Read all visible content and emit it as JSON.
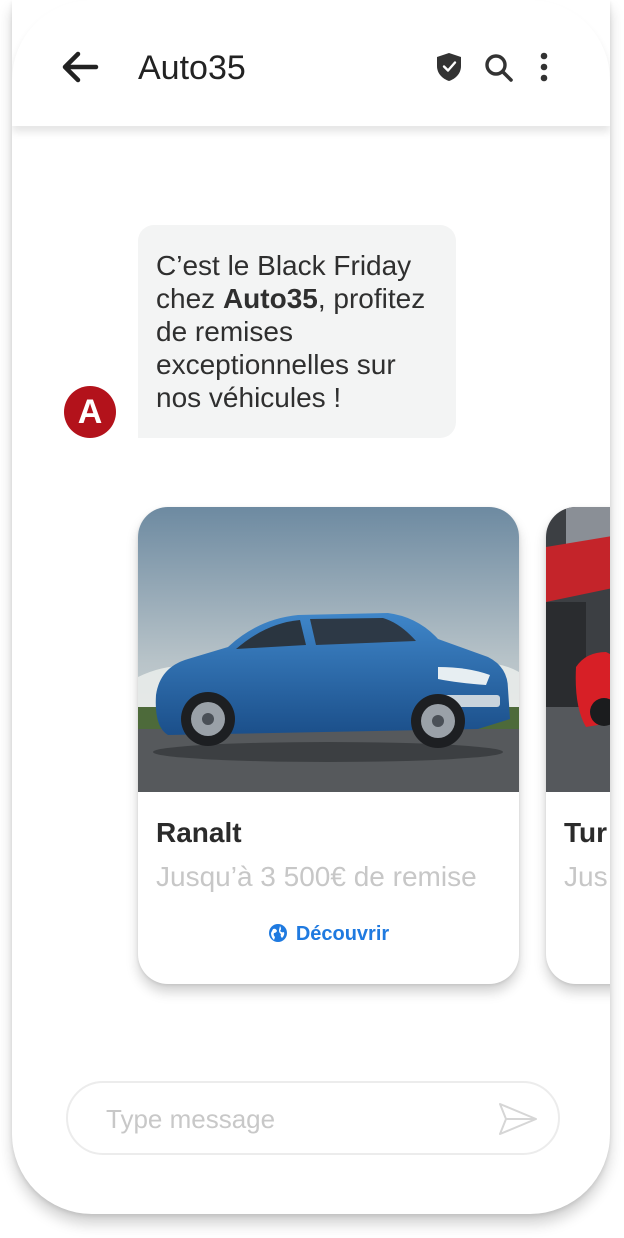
{
  "header": {
    "title": "Auto35",
    "back_icon": "arrow-left",
    "verified_icon": "shield-check",
    "search_icon": "search",
    "menu_icon": "more-vertical"
  },
  "sender": {
    "avatar_initial": "A",
    "avatar_color": "#b3121b"
  },
  "message": {
    "text_before": "C’est le Black Friday chez ",
    "text_bold": "Auto35",
    "text_after": ", profitez de remises exceptionnelles sur nos véhicules !"
  },
  "carousel": {
    "cards": [
      {
        "title": "Ranalt",
        "subtitle": "Jusqu’à 3 500€ de remise",
        "action_label": "Découvrir",
        "action_icon": "globe",
        "image": "blue-sedan"
      },
      {
        "title": "Tur",
        "subtitle": "Jus",
        "image": "red-car"
      }
    ]
  },
  "composer": {
    "placeholder": "Type message",
    "send_icon": "send"
  },
  "colors": {
    "accent": "#1f7ae0",
    "bubble_bg": "#f3f4f4",
    "muted_text": "#c7c7c7"
  }
}
